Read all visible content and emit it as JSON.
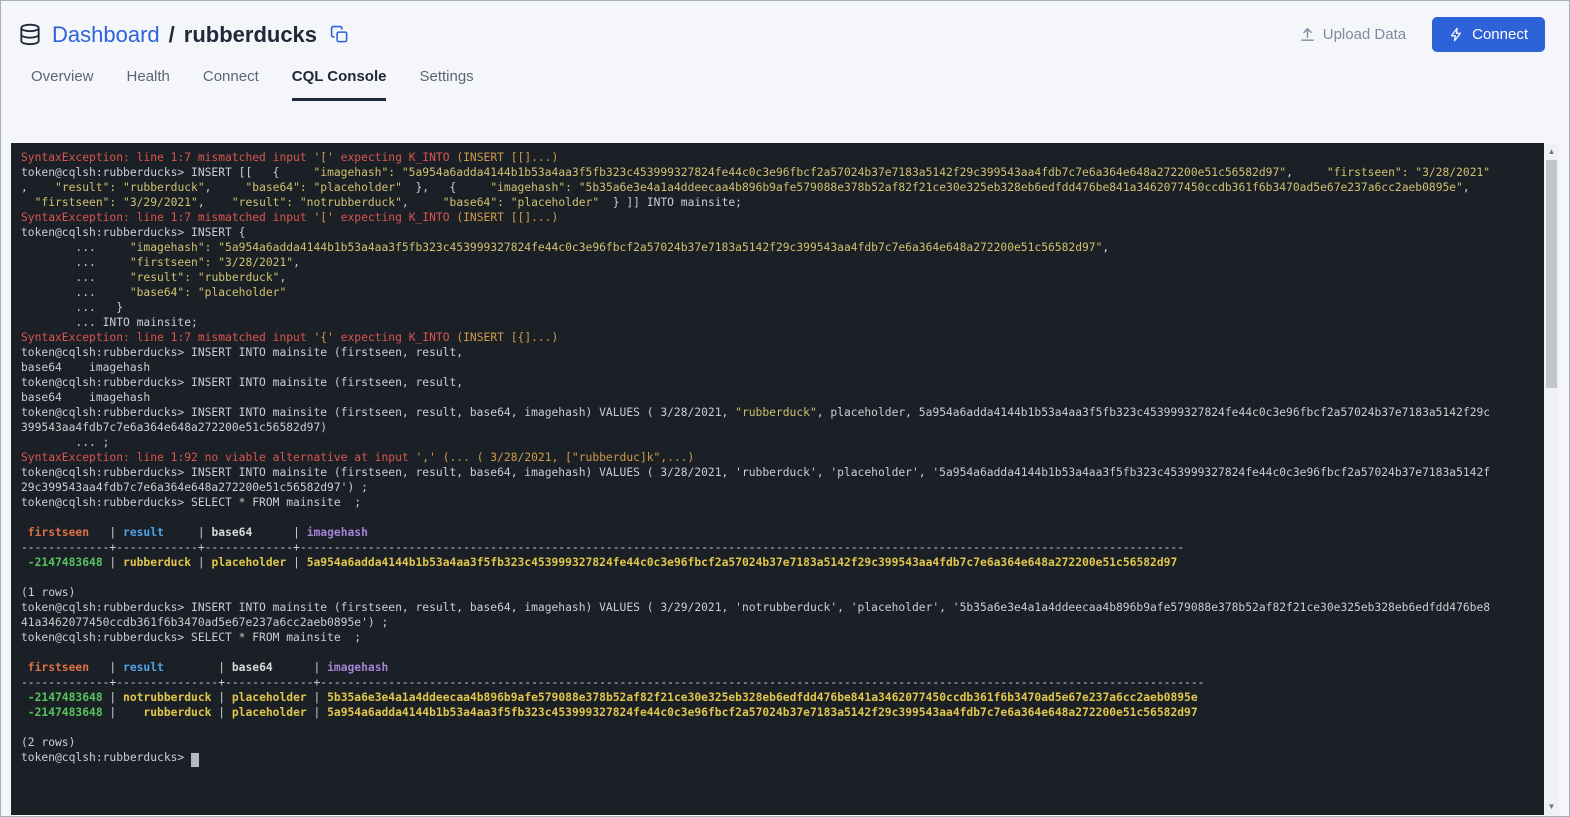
{
  "header": {
    "breadcrumb": {
      "section": "Dashboard",
      "separator": "/",
      "name": "rubberducks"
    },
    "actions": {
      "upload": "Upload Data",
      "connect": "Connect"
    }
  },
  "tabs": [
    {
      "id": "overview",
      "label": "Overview",
      "active": false
    },
    {
      "id": "health",
      "label": "Health",
      "active": false
    },
    {
      "id": "connect",
      "label": "Connect",
      "active": false
    },
    {
      "id": "cql-console",
      "label": "CQL Console",
      "active": true
    },
    {
      "id": "settings",
      "label": "Settings",
      "active": false
    }
  ],
  "icons": {
    "scroll_up": "▲",
    "scroll_down": "▼"
  },
  "colors": {
    "accent-blue": "#2e62d9",
    "upload-gray": "#7d8ba1",
    "tab-gray": "#5b6675",
    "ink": "#20293a",
    "page-bg": "#f5f6fa",
    "console-bg": "#1b2026",
    "c-plain": "#c9ced4",
    "c-error": "#d95550",
    "c-warn": "#cf9a4a",
    "c-string": "#cfc070",
    "c-green": "#56c45e",
    "c-value": "#e0c64a",
    "col-firstseen": "#de7045",
    "col-result": "#4da3e8",
    "col-base64": "#d5d9de",
    "col-imagehash": "#a383d9",
    "sb-track": "#eff1f4",
    "sb-thumb": "#c2c6cc"
  },
  "console": {
    "lines": [
      [
        [
          "e",
          "SyntaxException: line 1:7 mismatched input "
        ],
        [
          "w",
          "'['"
        ],
        [
          "e",
          " expecting K_INTO "
        ],
        [
          "w",
          "(INSERT [[]...)"
        ]
      ],
      [
        [
          "p",
          "token@cqlsh:rubberducks> INSERT [[   {     "
        ],
        [
          "y",
          "\"imagehash\": \"5a954a6adda4144b1b53a4aa3f5fb323c453999327824fe44c0c3e96fbcf2a57024b37e7183a5142f29c399543aa4fdb7c7e6a364e648a272200e51c56582d97\""
        ],
        [
          "p",
          ",     "
        ],
        [
          "y",
          "\"firstseen\": \"3/28/2021\""
        ]
      ],
      [
        [
          "p",
          ",    "
        ],
        [
          "y",
          "\"result\": \"rubberduck\""
        ],
        [
          "p",
          ",     "
        ],
        [
          "y",
          "\"base64\": \"placeholder\""
        ],
        [
          "p",
          "  },   {     "
        ],
        [
          "y",
          "\"imagehash\": \"5b35a6e3e4a1a4ddeecaa4b896b9afe579088e378b52af82f21ce30e325eb328eb6edfdd476be841a3462077450ccdb361f6b3470ad5e67e237a6cc2aeb0895e\""
        ],
        [
          "p",
          ","
        ]
      ],
      [
        [
          "p",
          "  "
        ],
        [
          "y",
          "\"firstseen\": \"3/29/2021\""
        ],
        [
          "p",
          ",    "
        ],
        [
          "y",
          "\"result\": \"notrubberduck\""
        ],
        [
          "p",
          ",     "
        ],
        [
          "y",
          "\"base64\": \"placeholder\""
        ],
        [
          "p",
          "  } ]] INTO mainsite;"
        ]
      ],
      [
        [
          "e",
          "SyntaxException: line 1:7 mismatched input "
        ],
        [
          "w",
          "'['"
        ],
        [
          "e",
          " expecting K_INTO "
        ],
        [
          "w",
          "(INSERT [[]...)"
        ]
      ],
      [
        [
          "p",
          "token@cqlsh:rubberducks> INSERT {"
        ]
      ],
      [
        [
          "p",
          "        ...     "
        ],
        [
          "y",
          "\"imagehash\": \"5a954a6adda4144b1b53a4aa3f5fb323c453999327824fe44c0c3e96fbcf2a57024b37e7183a5142f29c399543aa4fdb7c7e6a364e648a272200e51c56582d97\""
        ],
        [
          "p",
          ","
        ]
      ],
      [
        [
          "p",
          "        ...     "
        ],
        [
          "y",
          "\"firstseen\": \"3/28/2021\""
        ],
        [
          "p",
          ","
        ]
      ],
      [
        [
          "p",
          "        ...     "
        ],
        [
          "y",
          "\"result\": \"rubberduck\""
        ],
        [
          "p",
          ","
        ]
      ],
      [
        [
          "p",
          "        ...     "
        ],
        [
          "y",
          "\"base64\": \"placeholder\""
        ]
      ],
      [
        [
          "p",
          "        ...   }"
        ]
      ],
      [
        [
          "p",
          "        ... INTO mainsite;"
        ]
      ],
      [
        [
          "e",
          "SyntaxException: line 1:7 mismatched input "
        ],
        [
          "w",
          "'{'"
        ],
        [
          "e",
          " expecting K_INTO "
        ],
        [
          "w",
          "(INSERT [{]...)"
        ]
      ],
      [
        [
          "p",
          "token@cqlsh:rubberducks> INSERT INTO mainsite (firstseen, result,"
        ]
      ],
      [
        [
          "p",
          "base64    imagehash"
        ]
      ],
      [
        [
          "p",
          "token@cqlsh:rubberducks> INSERT INTO mainsite (firstseen, result,"
        ]
      ],
      [
        [
          "p",
          "base64    imagehash"
        ]
      ],
      [
        [
          "p",
          "token@cqlsh:rubberducks> INSERT INTO mainsite (firstseen, result, base64, imagehash) VALUES ( 3/28/2021, "
        ],
        [
          "y",
          "\"rubberduck\""
        ],
        [
          "p",
          ", placeholder, 5a954a6adda4144b1b53a4aa3f5fb323c453999327824fe44c0c3e96fbcf2a57024b37e7183a5142f29c"
        ]
      ],
      [
        [
          "p",
          "399543aa4fdb7c7e6a364e648a272200e51c56582d97)"
        ]
      ],
      [
        [
          "p",
          "        ... ;"
        ]
      ],
      [
        [
          "e",
          "SyntaxException: line 1:92 no viable alternative at input "
        ],
        [
          "w",
          "','"
        ],
        [
          "e",
          " "
        ],
        [
          "w",
          "(... ( 3/28/2021, [\"rubberduc]k\",...)"
        ]
      ],
      [
        [
          "p",
          "token@cqlsh:rubberducks> INSERT INTO mainsite (firstseen, result, base64, imagehash) VALUES ( 3/28/2021, 'rubberduck', 'placeholder', '5a954a6adda4144b1b53a4aa3f5fb323c453999327824fe44c0c3e96fbcf2a57024b37e7183a5142f"
        ]
      ],
      [
        [
          "p",
          "29c399543aa4fdb7c7e6a364e648a272200e51c56582d97') ;"
        ]
      ],
      [
        [
          "p",
          "token@cqlsh:rubberducks> SELECT * FROM mainsite  ;"
        ]
      ],
      [],
      [
        [
          "hf",
          " firstseen"
        ],
        [
          "p",
          "   | "
        ],
        [
          "hr",
          "result"
        ],
        [
          "p",
          "     | "
        ],
        [
          "hb",
          "base64"
        ],
        [
          "p",
          "      | "
        ],
        [
          "hh",
          "imagehash"
        ]
      ],
      {
        "sep": [
          13,
          12,
          13,
          130
        ]
      },
      [
        [
          "g",
          " -2147483648"
        ],
        [
          "p",
          " | "
        ],
        [
          "v",
          "rubberduck"
        ],
        [
          "p",
          " | "
        ],
        [
          "v",
          "placeholder"
        ],
        [
          "p",
          " | "
        ],
        [
          "v",
          "5a954a6adda4144b1b53a4aa3f5fb323c453999327824fe44c0c3e96fbcf2a57024b37e7183a5142f29c399543aa4fdb7c7e6a364e648a272200e51c56582d97"
        ]
      ],
      [],
      [
        [
          "p",
          "(1 rows)"
        ]
      ],
      [
        [
          "p",
          "token@cqlsh:rubberducks> INSERT INTO mainsite (firstseen, result, base64, imagehash) VALUES ( 3/29/2021, 'notrubberduck', 'placeholder', '5b35a6e3e4a1a4ddeecaa4b896b9afe579088e378b52af82f21ce30e325eb328eb6edfdd476be8"
        ]
      ],
      [
        [
          "p",
          "41a3462077450ccdb361f6b3470ad5e67e237a6cc2aeb0895e') ;"
        ]
      ],
      [
        [
          "p",
          "token@cqlsh:rubberducks> SELECT * FROM mainsite  ;"
        ]
      ],
      [],
      [
        [
          "hf",
          " firstseen"
        ],
        [
          "p",
          "   | "
        ],
        [
          "hr",
          "result"
        ],
        [
          "p",
          "        | "
        ],
        [
          "hb",
          "base64"
        ],
        [
          "p",
          "      | "
        ],
        [
          "hh",
          "imagehash"
        ]
      ],
      {
        "sep": [
          13,
          15,
          13,
          130
        ]
      },
      [
        [
          "g",
          " -2147483648"
        ],
        [
          "p",
          " | "
        ],
        [
          "v",
          "notrubberduck"
        ],
        [
          "p",
          " | "
        ],
        [
          "v",
          "placeholder"
        ],
        [
          "p",
          " | "
        ],
        [
          "v",
          "5b35a6e3e4a1a4ddeecaa4b896b9afe579088e378b52af82f21ce30e325eb328eb6edfdd476be841a3462077450ccdb361f6b3470ad5e67e237a6cc2aeb0895e"
        ]
      ],
      [
        [
          "g",
          " -2147483648"
        ],
        [
          "p",
          " | "
        ],
        [
          "v",
          "   rubberduck"
        ],
        [
          "p",
          " | "
        ],
        [
          "v",
          "placeholder"
        ],
        [
          "p",
          " | "
        ],
        [
          "v",
          "5a954a6adda4144b1b53a4aa3f5fb323c453999327824fe44c0c3e96fbcf2a57024b37e7183a5142f29c399543aa4fdb7c7e6a364e648a272200e51c56582d97"
        ]
      ],
      [],
      [
        [
          "p",
          "(2 rows)"
        ]
      ],
      [
        [
          "p",
          "token@cqlsh:rubberducks> "
        ],
        [
          "cur",
          " "
        ]
      ]
    ]
  }
}
